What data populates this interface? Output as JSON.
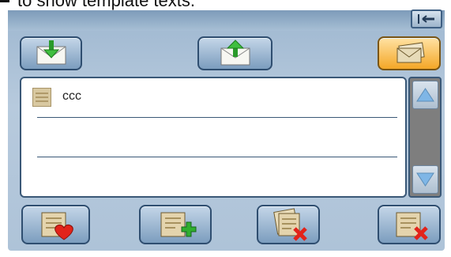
{
  "caption": {
    "text": "to show  template texts."
  },
  "list": {
    "items": [
      {
        "label": "ccc"
      },
      {
        "label": ""
      }
    ]
  },
  "icons": {
    "back": "back-arrow-icon",
    "inbox": "envelope-down-arrow-icon",
    "outbox": "envelope-up-arrow-icon",
    "templates": "envelope-stack-icon",
    "favorite": "note-heart-icon",
    "add": "note-plus-icon",
    "delete_all": "notes-delete-icon",
    "delete": "note-delete-icon",
    "scroll_up": "triangle-up-icon",
    "scroll_down": "triangle-down-icon"
  },
  "colors": {
    "panel": "#aec3d8",
    "active_tab": "#f4a727",
    "accent_green": "#2fae2f",
    "accent_red": "#e2231a"
  }
}
